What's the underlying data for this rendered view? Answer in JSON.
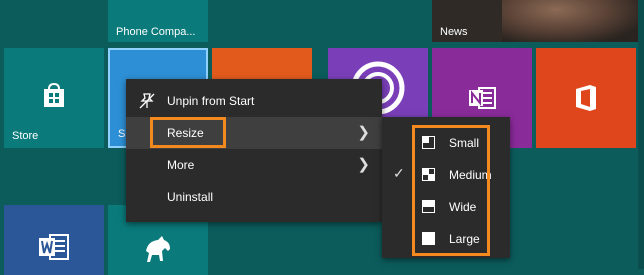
{
  "tiles": {
    "phone_companion": "Phone Compa...",
    "news": "News",
    "store": "Store",
    "sk_partial": "Sk"
  },
  "context_menu": {
    "unpin": "Unpin from Start",
    "resize": "Resize",
    "more": "More",
    "uninstall": "Uninstall"
  },
  "resize_submenu": {
    "items": [
      "Small",
      "Medium",
      "Wide",
      "Large"
    ],
    "selected": "Medium"
  },
  "colors": {
    "highlight": "#f28a1f",
    "start_bg": "#0c5c5c",
    "menu_bg": "#2b2b2b"
  },
  "icons": [
    "unpin-icon",
    "chevron-right-icon",
    "check-icon",
    "store-icon",
    "onenote-icon",
    "office-icon",
    "word-icon",
    "horse-icon",
    "camera-icon"
  ]
}
